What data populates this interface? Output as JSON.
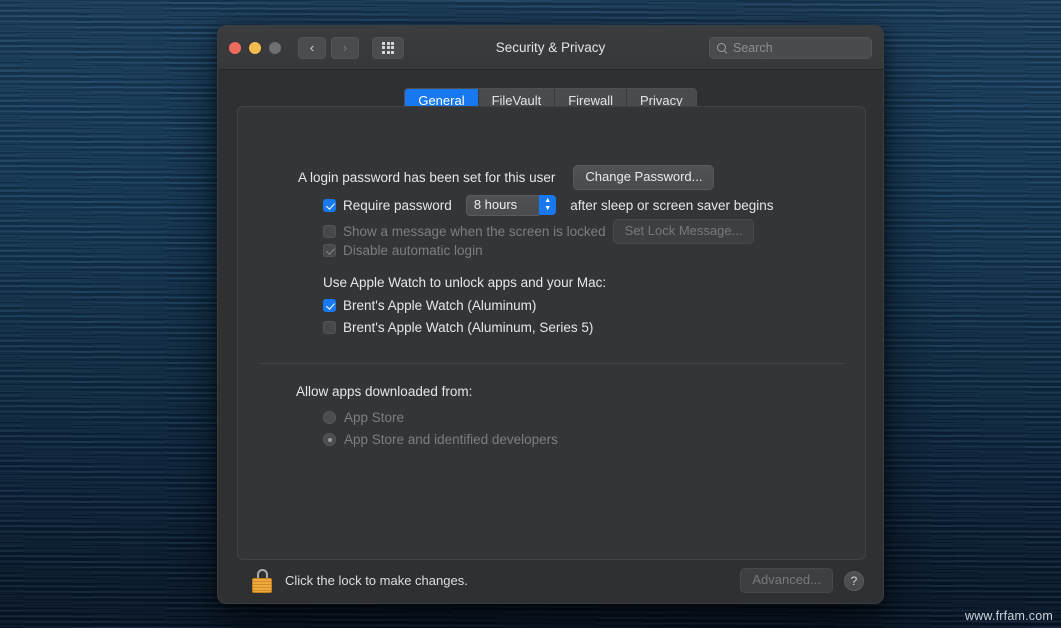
{
  "window": {
    "title": "Security & Privacy",
    "traffic_lights": {
      "close": "close-button",
      "minimize": "minimize-button",
      "zoom": "zoom-button"
    },
    "nav": {
      "back": "‹",
      "forward": "›"
    },
    "grid_button": "show-all-preferences"
  },
  "search": {
    "placeholder": "Search",
    "value": ""
  },
  "tabs": [
    {
      "label": "General",
      "active": true
    },
    {
      "label": "FileVault",
      "active": false
    },
    {
      "label": "Firewall",
      "active": false
    },
    {
      "label": "Privacy",
      "active": false
    }
  ],
  "general": {
    "password_status": "A login password has been set for this user",
    "change_password_button": "Change Password...",
    "require_password": {
      "label_before": "Require password",
      "duration": "8 hours",
      "label_after": "after sleep or screen saver begins",
      "checked": true
    },
    "show_message": {
      "label": "Show a message when the screen is locked",
      "button": "Set Lock Message...",
      "checked": false,
      "enabled": false
    },
    "disable_automatic_login": {
      "label": "Disable automatic login",
      "checked": true,
      "enabled": false
    },
    "apple_watch": {
      "heading": "Use Apple Watch to unlock apps and your Mac:",
      "devices": [
        {
          "label": "Brent's Apple Watch (Aluminum)",
          "checked": true
        },
        {
          "label": "Brent's Apple Watch (Aluminum, Series 5)",
          "checked": false
        }
      ]
    },
    "allow_apps": {
      "heading": "Allow apps downloaded from:",
      "options": [
        {
          "label": "App Store",
          "selected": false
        },
        {
          "label": "App Store and identified developers",
          "selected": true
        }
      ]
    }
  },
  "footer": {
    "lock_text": "Click the lock to make changes.",
    "advanced_button": "Advanced...",
    "help_button": "?"
  },
  "watermark": "www.frfam.com",
  "colors": {
    "accent_blue": "#1878f0",
    "window_bg": "#2f3031",
    "panel_bg": "#343536",
    "lock_gold": "#f0a93c"
  }
}
